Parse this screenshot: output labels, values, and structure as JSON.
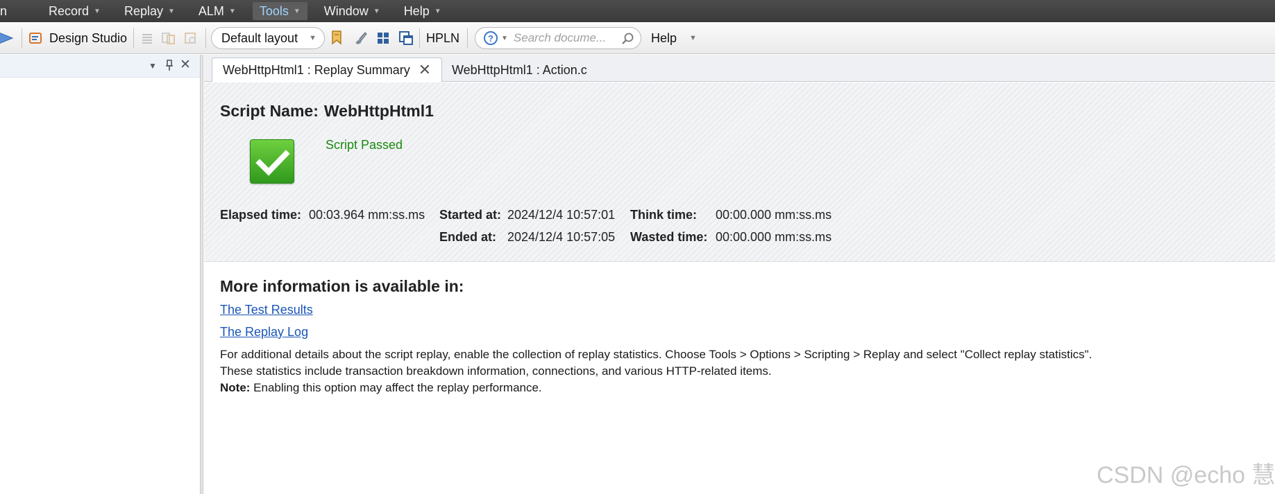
{
  "menu": {
    "items": [
      {
        "label": "n"
      },
      {
        "label": "Record"
      },
      {
        "label": "Replay"
      },
      {
        "label": "ALM"
      },
      {
        "label": "Tools"
      },
      {
        "label": "Window"
      },
      {
        "label": "Help"
      }
    ]
  },
  "toolbar": {
    "design_studio_label": "Design Studio",
    "layout_value": "Default layout",
    "hpln_label": "HPLN",
    "search_placeholder": "Search docume...",
    "help_label": "Help"
  },
  "tabs": [
    {
      "label": "WebHttpHtml1 : Replay Summary",
      "active": true
    },
    {
      "label": "WebHttpHtml1 : Action.c",
      "active": false
    }
  ],
  "summary": {
    "script_name_label": "Script Name:",
    "script_name": "WebHttpHtml1",
    "status_text": "Script Passed",
    "status_color": "#1a8a10",
    "elapsed_label": "Elapsed time:",
    "elapsed_value": "00:03.964 mm:ss.ms",
    "started_label": "Started at:",
    "started_value": "2024/12/4 10:57:01",
    "ended_label": "Ended at:",
    "ended_value": "2024/12/4 10:57:05",
    "think_label": "Think time:",
    "think_value": "00:00.000 mm:ss.ms",
    "wasted_label": "Wasted time:",
    "wasted_value": "00:00.000 mm:ss.ms"
  },
  "more_info": {
    "title": "More information is available in:",
    "link_results": "The Test Results",
    "link_log": "The Replay Log",
    "line1": "For additional details about the script replay, enable the collection of replay statistics. Choose Tools > Options > Scripting > Replay and select \"Collect replay statistics\".",
    "line2": "These statistics include transaction breakdown information, connections, and various HTTP-related items.",
    "note_label": "Note:",
    "note_text": " Enabling this option may affect the replay performance."
  },
  "watermark": "CSDN @echo 慧"
}
